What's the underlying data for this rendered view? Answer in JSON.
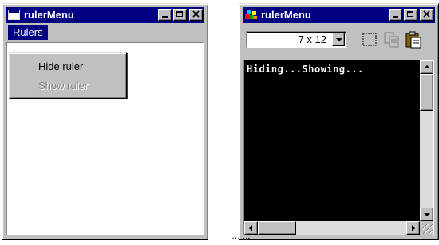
{
  "left_window": {
    "title": "rulerMenu",
    "icon": "app-window-icon",
    "menubar": {
      "menu_label": "Rulers"
    },
    "menu_items": [
      {
        "label": "Hide ruler",
        "enabled": true
      },
      {
        "label": "Show ruler",
        "enabled": false
      }
    ]
  },
  "right_window": {
    "title": "rulerMenu",
    "icon": "app-colorful-icon",
    "toolbar": {
      "font_size": "7 x 12",
      "buttons": [
        "select-icon",
        "copy-icon",
        "paste-icon"
      ]
    },
    "terminal_text": "Hiding...Showing..."
  },
  "caption_fragment": "… ..."
}
